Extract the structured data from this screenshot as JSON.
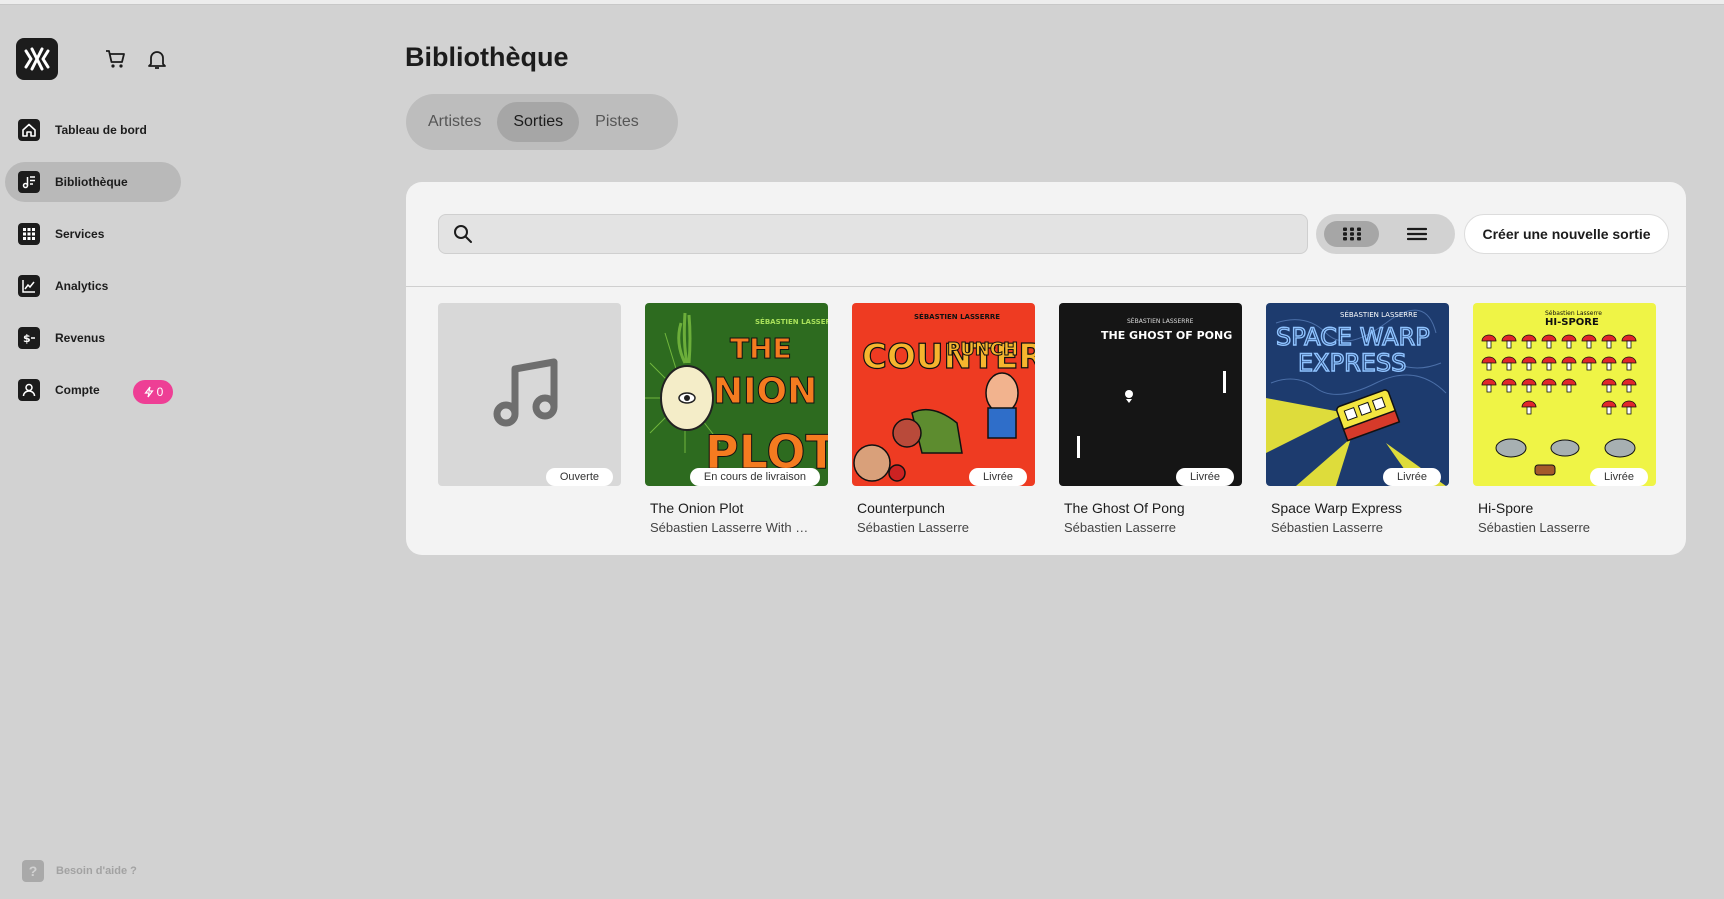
{
  "sidebar": {
    "logo_icon": "waveform-logo-icon",
    "cart_icon": "cart-icon",
    "bell_icon": "bell-icon",
    "items": [
      {
        "label": "Tableau de bord",
        "icon": "home-icon",
        "active": false
      },
      {
        "label": "Bibliothèque",
        "icon": "music-library-icon",
        "active": true
      },
      {
        "label": "Services",
        "icon": "grid-icon",
        "active": false
      },
      {
        "label": "Analytics",
        "icon": "chart-icon",
        "active": false
      },
      {
        "label": "Revenus",
        "icon": "dollar-icon",
        "active": false
      },
      {
        "label": "Compte",
        "icon": "user-icon",
        "active": false
      }
    ],
    "account_badge": "0",
    "help_label": "Besoin d'aide ?",
    "help_icon": "?"
  },
  "header": {
    "title": "Bibliothèque",
    "tabs": [
      {
        "label": "Artistes",
        "active": false
      },
      {
        "label": "Sorties",
        "active": true
      },
      {
        "label": "Pistes",
        "active": false
      }
    ]
  },
  "toolbar": {
    "search_placeholder": "",
    "create_label": "Créer une nouvelle sortie"
  },
  "releases": [
    {
      "title": "",
      "artist": "",
      "status": "Ouverte",
      "cover": "placeholder"
    },
    {
      "title": "The Onion Plot",
      "artist": "Sébastien Lasserre With Nac Nac",
      "status": "En cours de livraison",
      "cover": "onion"
    },
    {
      "title": "Counterpunch",
      "artist": "Sébastien Lasserre",
      "status": "Livrée",
      "cover": "counterpunch"
    },
    {
      "title": "The Ghost Of Pong",
      "artist": "Sébastien Lasserre",
      "status": "Livrée",
      "cover": "ghost"
    },
    {
      "title": "Space Warp Express",
      "artist": "Sébastien Lasserre",
      "status": "Livrée",
      "cover": "spacewarp"
    },
    {
      "title": "Hi-Spore",
      "artist": "Sébastien Lasserre",
      "status": "Livrée",
      "cover": "hispore"
    }
  ],
  "covers_text": {
    "onion": {
      "artist": "SÉBASTIEN LASSERRE & NAC NAC",
      "title": "THE ONION PLOT"
    },
    "counterpunch": {
      "artist": "SÉBASTIEN LASSERRE",
      "title": "COUNTERPUNCH"
    },
    "ghost": {
      "artist": "SÉBASTIEN LASSERRE",
      "title": "THE GHOST OF PONG"
    },
    "spacewarp": {
      "artist": "SÉBASTIEN LASSERRE",
      "title": "SPACE WARP EXPRESS"
    },
    "hispore": {
      "artist": "Sébastien Lasserre",
      "title": "HI-SPORE"
    }
  },
  "colors": {
    "accent_badge": "#ee3f95",
    "active_tab": "#a6a6a6",
    "panel": "#f3f3f3"
  }
}
